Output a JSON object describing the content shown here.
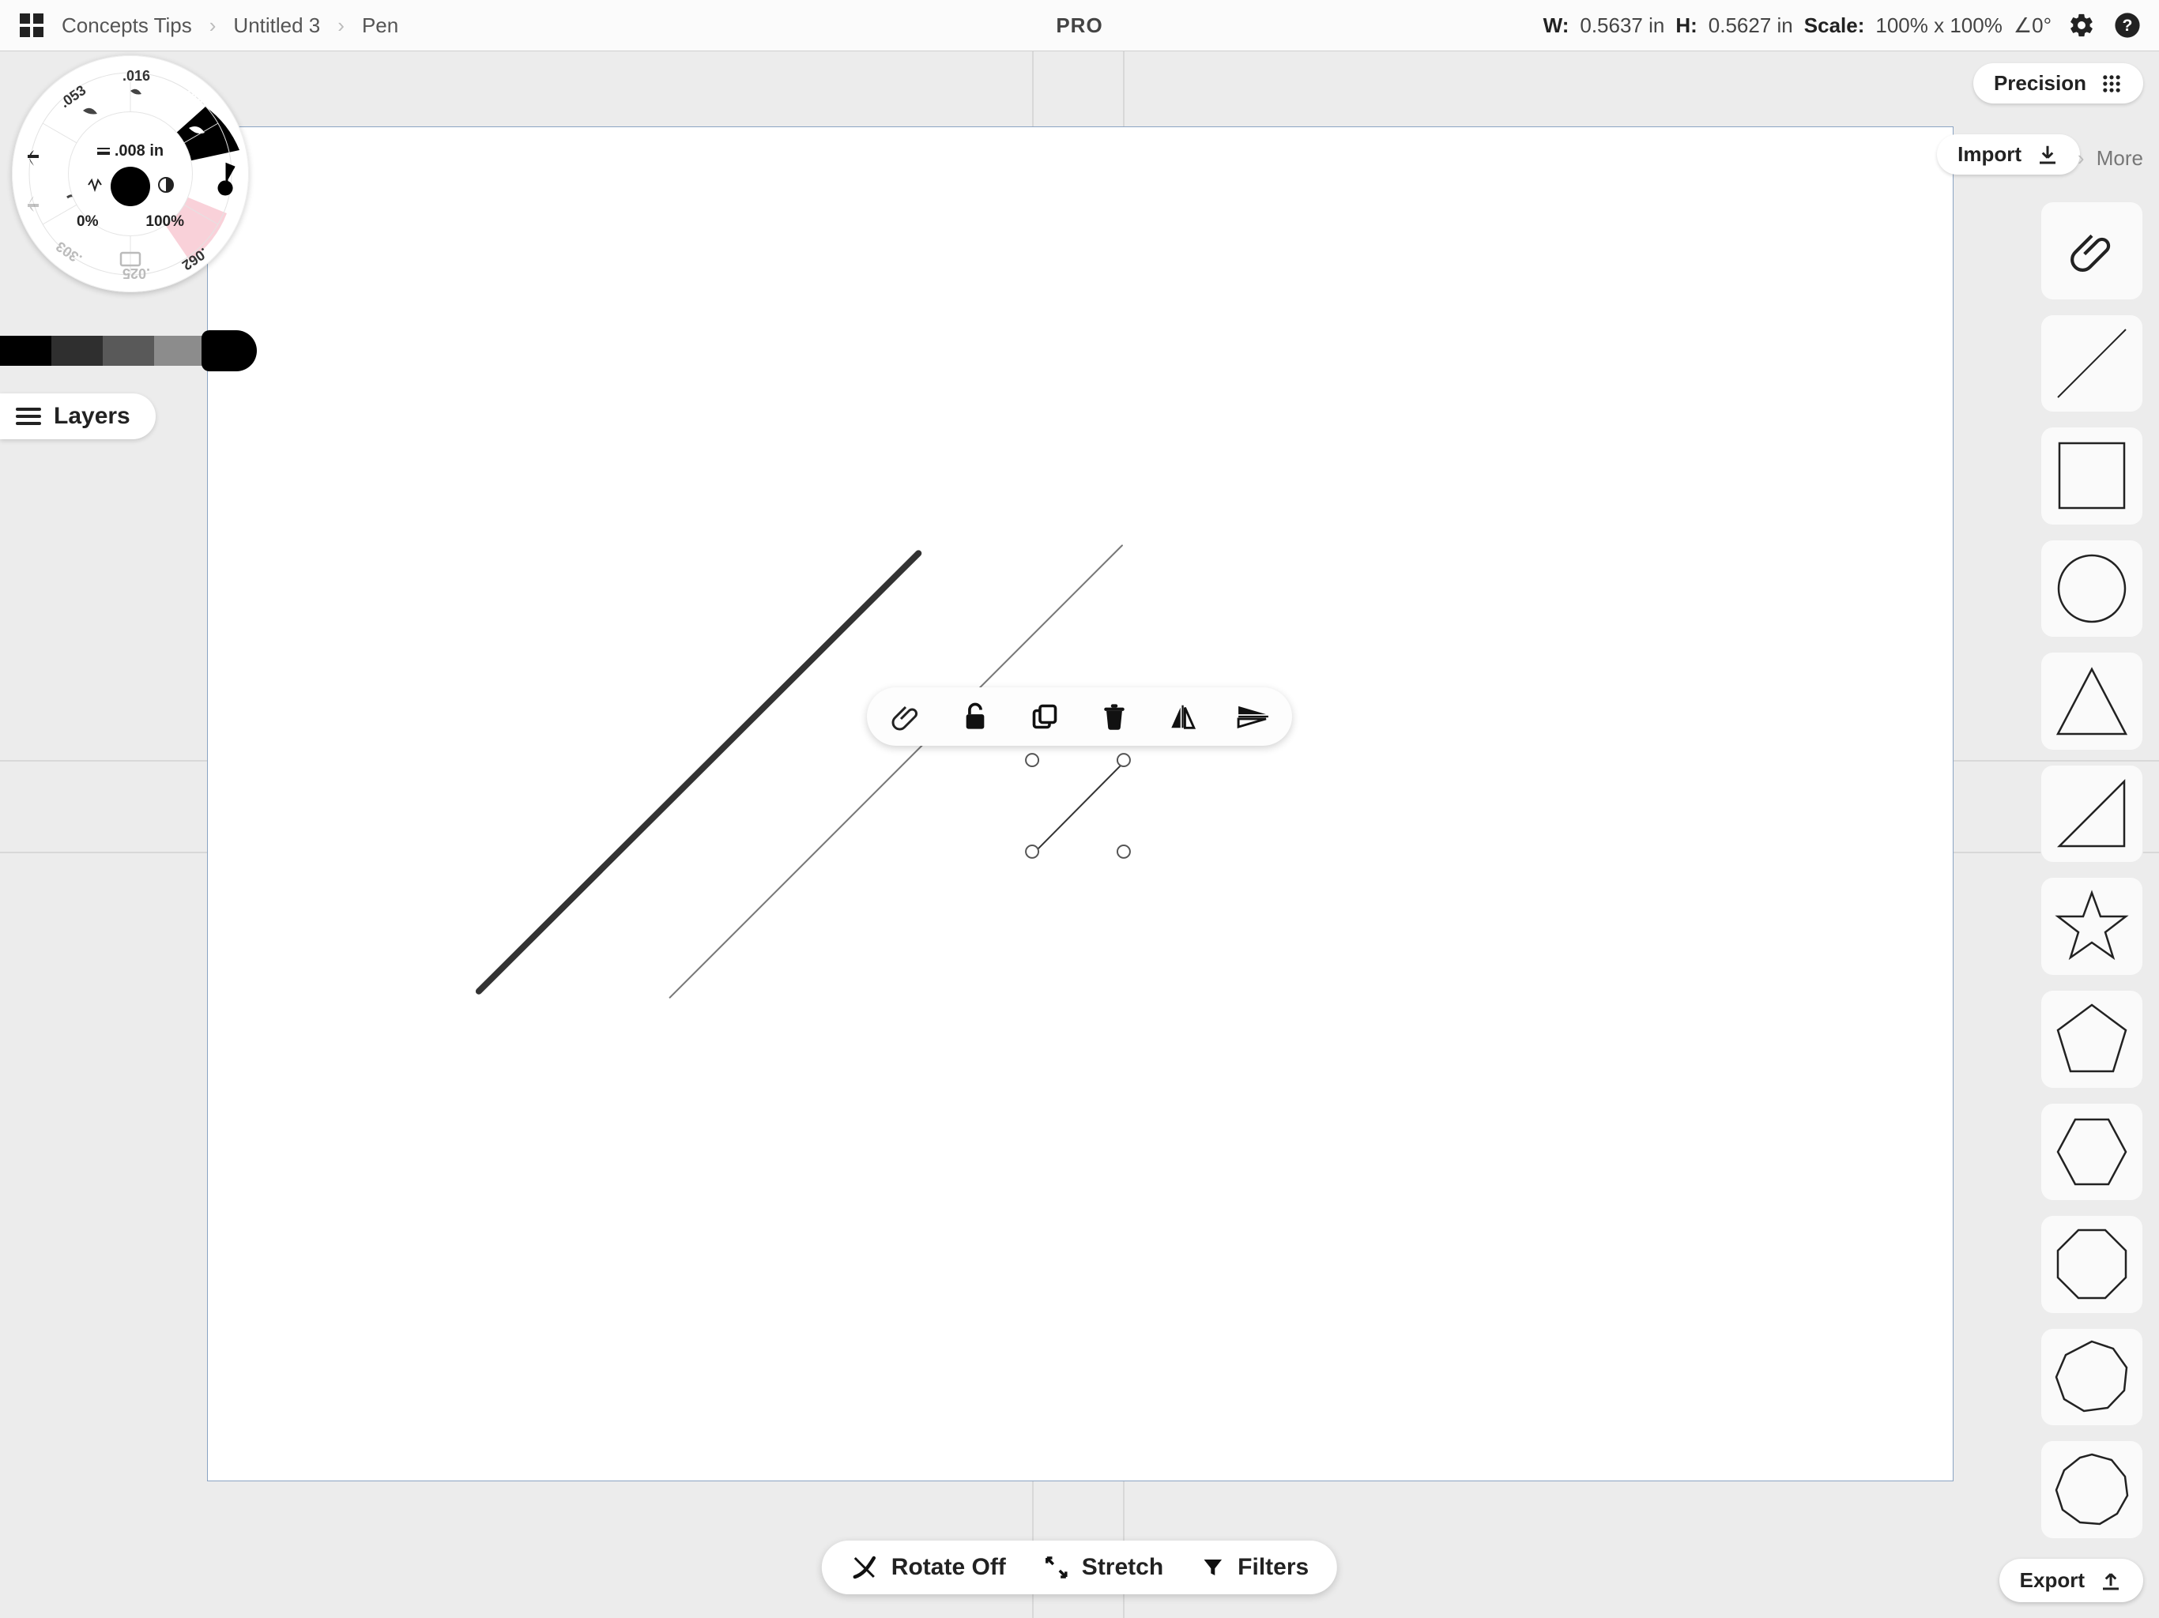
{
  "topbar": {
    "breadcrumb": [
      "Concepts Tips",
      "Untitled 3",
      "Pen"
    ],
    "pro_badge": "PRO",
    "width_label": "W:",
    "width_value": "0.5637 in",
    "height_label": "H:",
    "height_value": "0.5627 in",
    "scale_label": "Scale:",
    "scale_value": "100% x 100%",
    "angle_label": "∠",
    "angle_value": "0°"
  },
  "precision": {
    "label": "Precision"
  },
  "import": {
    "label": "Import"
  },
  "more": {
    "label": "More"
  },
  "export": {
    "label": "Export"
  },
  "layers": {
    "label": "Layers"
  },
  "tool_wheel": {
    "size_label": ".008 in",
    "opacity_left": "0%",
    "opacity_right": "100%",
    "slot_sizes": [
      ".053",
      ".016",
      ".008",
      ".062",
      ".025",
      ".303"
    ]
  },
  "color_strip": {
    "swatches": [
      "#000000",
      "#2f2f2f",
      "#595959",
      "#8c8c8c"
    ]
  },
  "bottom_actions": {
    "rotate": "Rotate Off",
    "stretch": "Stretch",
    "filters": "Filters"
  },
  "shapes": [
    "attach-icon",
    "line",
    "square",
    "circle",
    "triangle",
    "right-triangle",
    "star",
    "pentagon",
    "hexagon",
    "octagon",
    "nonagon",
    "decagon"
  ],
  "context_toolbar": [
    "attach-icon",
    "lock-icon",
    "duplicate-icon",
    "trash-icon",
    "flip-h-icon",
    "flip-v-icon"
  ]
}
